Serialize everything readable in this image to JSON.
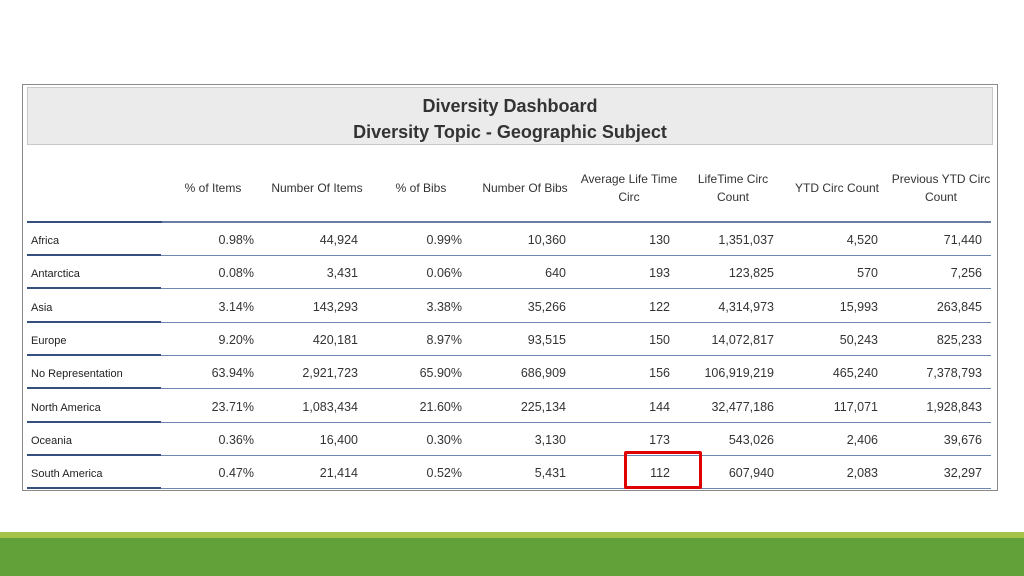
{
  "dashboard": {
    "title": "Diversity Dashboard",
    "subtitle": "Diversity Topic - Geographic Subject"
  },
  "table": {
    "headers": [
      "% of Items",
      "Number Of Items",
      "% of Bibs",
      "Number Of Bibs",
      "Average Life Time Circ",
      "LifeTime Circ Count",
      "YTD Circ Count",
      "Previous YTD Circ Count"
    ],
    "rows": [
      {
        "name": "Africa",
        "values": [
          "0.98%",
          "44,924",
          "0.99%",
          "10,360",
          "130",
          "1,351,037",
          "4,520",
          "71,440"
        ]
      },
      {
        "name": "Antarctica",
        "values": [
          "0.08%",
          "3,431",
          "0.06%",
          "640",
          "193",
          "123,825",
          "570",
          "7,256"
        ]
      },
      {
        "name": "Asia",
        "values": [
          "3.14%",
          "143,293",
          "3.38%",
          "35,266",
          "122",
          "4,314,973",
          "15,993",
          "263,845"
        ]
      },
      {
        "name": "Europe",
        "values": [
          "9.20%",
          "420,181",
          "8.97%",
          "93,515",
          "150",
          "14,072,817",
          "50,243",
          "825,233"
        ]
      },
      {
        "name": "No Representation",
        "values": [
          "63.94%",
          "2,921,723",
          "65.90%",
          "686,909",
          "156",
          "106,919,219",
          "465,240",
          "7,378,793"
        ]
      },
      {
        "name": "North America",
        "values": [
          "23.71%",
          "1,083,434",
          "21.60%",
          "225,134",
          "144",
          "32,477,186",
          "117,071",
          "1,928,843"
        ]
      },
      {
        "name": "Oceania",
        "values": [
          "0.36%",
          "16,400",
          "0.30%",
          "3,130",
          "173",
          "543,026",
          "2,406",
          "39,676"
        ]
      },
      {
        "name": "South America",
        "values": [
          "0.47%",
          "21,414",
          "0.52%",
          "5,431",
          "112",
          "607,940",
          "2,083",
          "32,297"
        ]
      }
    ]
  },
  "colors": {
    "highlight": "#e00000",
    "footer_bar": "#62a03a",
    "footer_accent": "#a5c249",
    "row_divider": "#6f86b0"
  }
}
